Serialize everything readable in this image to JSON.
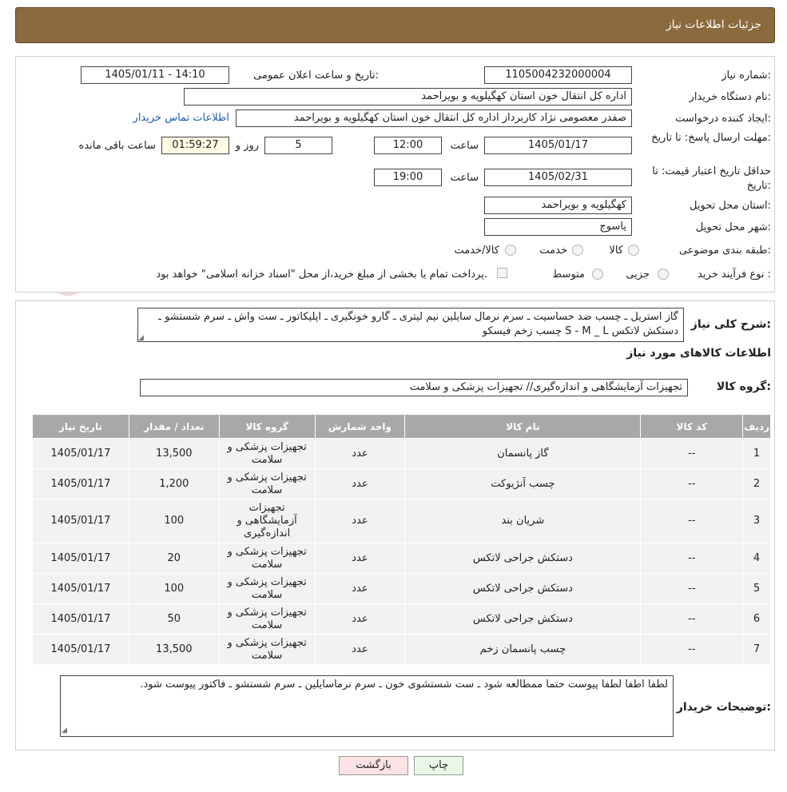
{
  "header": {
    "title": "جزئیات اطلاعات نیاز"
  },
  "fields": {
    "need_number_label": "شماره نیاز:",
    "need_number": "1105004232000004",
    "announce_label": "تاریخ و ساعت اعلان عمومی:",
    "announce_value": "1405/01/11 - 14:10",
    "buyer_org_label": "نام دستگاه خریدار:",
    "buyer_org": "اداره کل انتقال خون استان کهگیلویه و بویراحمد",
    "requester_label": "ایجاد کننده درخواست:",
    "requester": "صفدر معصومی نژاد کاربرداز اداره کل انتقال خون استان کهگیلویه و بویراحمد",
    "contact_link": "اطلاعات تماس خریدار",
    "deadline_label": "مهلت ارسال پاسخ: تا تاریخ:",
    "deadline_date": "1405/01/17",
    "time_label": "ساعت",
    "deadline_time": "12:00",
    "days": "5",
    "days_label": "روز و",
    "remaining": "01:59:27",
    "remaining_label": "ساعت باقی مانده",
    "validity_label": "حداقل تاریخ اعتبار قیمت: تا تاریخ:",
    "validity_date": "1405/02/31",
    "validity_time": "19:00",
    "province_label": "استان محل تحویل:",
    "province": "کهگیلویه و بویراحمد",
    "city_label": "شهر محل تحویل:",
    "city": "یاسوج",
    "category_label": "طبقه بندی موضوعی:",
    "category_options": [
      "کالا",
      "خدمت",
      "کالا/خدمت"
    ],
    "process_label": "نوع فرآیند خرید :",
    "process_options": [
      "جزیی",
      "متوسط"
    ],
    "payment_note": "پرداخت تمام یا بخشی از مبلغ خرید،از محل \"اسناد خزانه اسلامی\" خواهد بود."
  },
  "summary": {
    "label": "شرح کلی نیاز:",
    "text": "گاز استریل ـ چسب ضد حساسیت ـ سرم نرمال سایلین نیم لیتری ـ گارو خونگیری ـ اپلیکاتور ـ ست واش ـ سرم شستشو ـ دستکش لاتکس S - M _ L  چسب زخم فیسکو"
  },
  "goods": {
    "section_title": "اطلاعات کالاهای مورد نیاز",
    "group_label": "گروه کالا:",
    "group_value": "تجهیزات آزمایشگاهی و اندازه‌گیری// تجهیزات پزشکی و سلامت"
  },
  "table": {
    "headers": [
      "ردیف",
      "کد کالا",
      "نام کالا",
      "واحد شمارش",
      "گروه کالا",
      "تعداد / مقدار",
      "تاریخ نیاز"
    ],
    "rows": [
      [
        "1",
        "--",
        "گاز پانسمان",
        "عدد",
        "تجهیزات پزشکی و سلامت",
        "13,500",
        "1405/01/17"
      ],
      [
        "2",
        "--",
        "چسب آنژیوکت",
        "عدد",
        "تجهیزات پزشکی و سلامت",
        "1,200",
        "1405/01/17"
      ],
      [
        "3",
        "--",
        "شریان بند",
        "عدد",
        "تجهیزات آزمایشگاهی و اندازه‌گیری",
        "100",
        "1405/01/17"
      ],
      [
        "4",
        "--",
        "دستکش جراحی لاتکس",
        "عدد",
        "تجهیزات پزشکی و سلامت",
        "20",
        "1405/01/17"
      ],
      [
        "5",
        "--",
        "دستکش جراحی لاتکس",
        "عدد",
        "تجهیزات پزشکی و سلامت",
        "100",
        "1405/01/17"
      ],
      [
        "6",
        "--",
        "دستکش جراحی لاتکس",
        "عدد",
        "تجهیزات پزشکی و سلامت",
        "50",
        "1405/01/17"
      ],
      [
        "7",
        "--",
        "چسب پانسمان زخم",
        "عدد",
        "تجهیزات پزشکی و سلامت",
        "13,500",
        "1405/01/17"
      ]
    ]
  },
  "buyer_notes": {
    "label": "توضیحات خریدار:",
    "text": "لطفا اطفا لطفا پیوست حتما ممطالعه شود ـ ست شستشوی خون ـ سرم نرماسایلین ـ سرم شستشو ـ فاکتور پیوست شود."
  },
  "buttons": {
    "print": "چاپ",
    "back": "بازگشت"
  },
  "watermark": {
    "text": "AriaTender.neT"
  },
  "colors": {
    "header_bg": "#8b6a3e",
    "table_header": "#a8a8a8",
    "back_btn": "#fde3e3",
    "print_btn": "#eaf7e6"
  }
}
